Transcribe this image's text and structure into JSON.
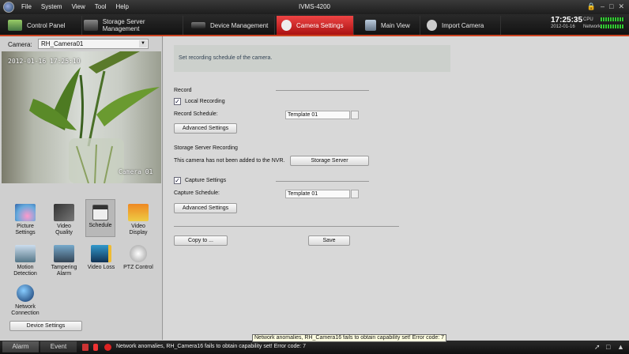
{
  "window": {
    "title": "IVMS-4200",
    "menu": [
      "File",
      "System",
      "View",
      "Tool",
      "Help"
    ]
  },
  "tabs": [
    {
      "label": "Control Panel",
      "active": false
    },
    {
      "label": "Storage Server Management",
      "active": false
    },
    {
      "label": "Device Management",
      "active": false
    },
    {
      "label": "Camera Settings",
      "active": true
    },
    {
      "label": "Main View",
      "active": false
    },
    {
      "label": "Import Camera",
      "active": false
    }
  ],
  "clock": {
    "time": "17:25:35",
    "date": "2012-01-16"
  },
  "sysmon": {
    "cpu_label": "CPU",
    "network_label": "Network"
  },
  "left": {
    "camera_label": "Camera:",
    "camera_value": "RH_Camera01",
    "preview": {
      "timestamp": "2012-01-16 17:25:10",
      "camera_name": "Camera 01"
    },
    "functions": [
      {
        "label": "Picture Settings",
        "icon": "picture-settings-icon"
      },
      {
        "label": "Video Quality",
        "icon": "video-quality-icon"
      },
      {
        "label": "Schedule",
        "icon": "schedule-icon",
        "selected": true
      },
      {
        "label": "Video Display",
        "icon": "video-display-icon"
      },
      {
        "label": "Motion Detection",
        "icon": "motion-detection-icon"
      },
      {
        "label": "Tampering Alarm",
        "icon": "tampering-alarm-icon"
      },
      {
        "label": "Video Loss",
        "icon": "video-loss-icon"
      },
      {
        "label": "PTZ Control",
        "icon": "ptz-control-icon"
      },
      {
        "label": "Network Connection",
        "icon": "network-connection-icon"
      }
    ],
    "device_settings_label": "Device Settings"
  },
  "main": {
    "hint": "Set recording schedule of the camera.",
    "record": {
      "heading": "Record",
      "local_recording_label": "Local Recording",
      "local_recording_checked": true,
      "schedule_label": "Record Schedule:",
      "schedule_value": "Template 01",
      "advanced_label": "Advanced Settings"
    },
    "storage": {
      "heading": "Storage Server Recording",
      "message": "This camera has not been added to the NVR.",
      "button_label": "Storage Server"
    },
    "capture": {
      "label": "Capture Settings",
      "checked": true,
      "schedule_label": "Capture Schedule:",
      "schedule_value": "Template 01",
      "advanced_label": "Advanced Settings"
    },
    "copy_label": "Copy to ...",
    "save_label": "Save"
  },
  "tooltip": "Network anomalies, RH_Camera16 fails to obtain capability set! Error code: 7",
  "statusbar": {
    "alarm_label": "Alarm",
    "event_label": "Event",
    "message": "Network anomalies, RH_Camera16 fails to obtain capability set! Error code: 7"
  },
  "colors": {
    "accent": "#cc2a22",
    "active_tab": "#d42a2a",
    "hint_text": "#334455"
  }
}
